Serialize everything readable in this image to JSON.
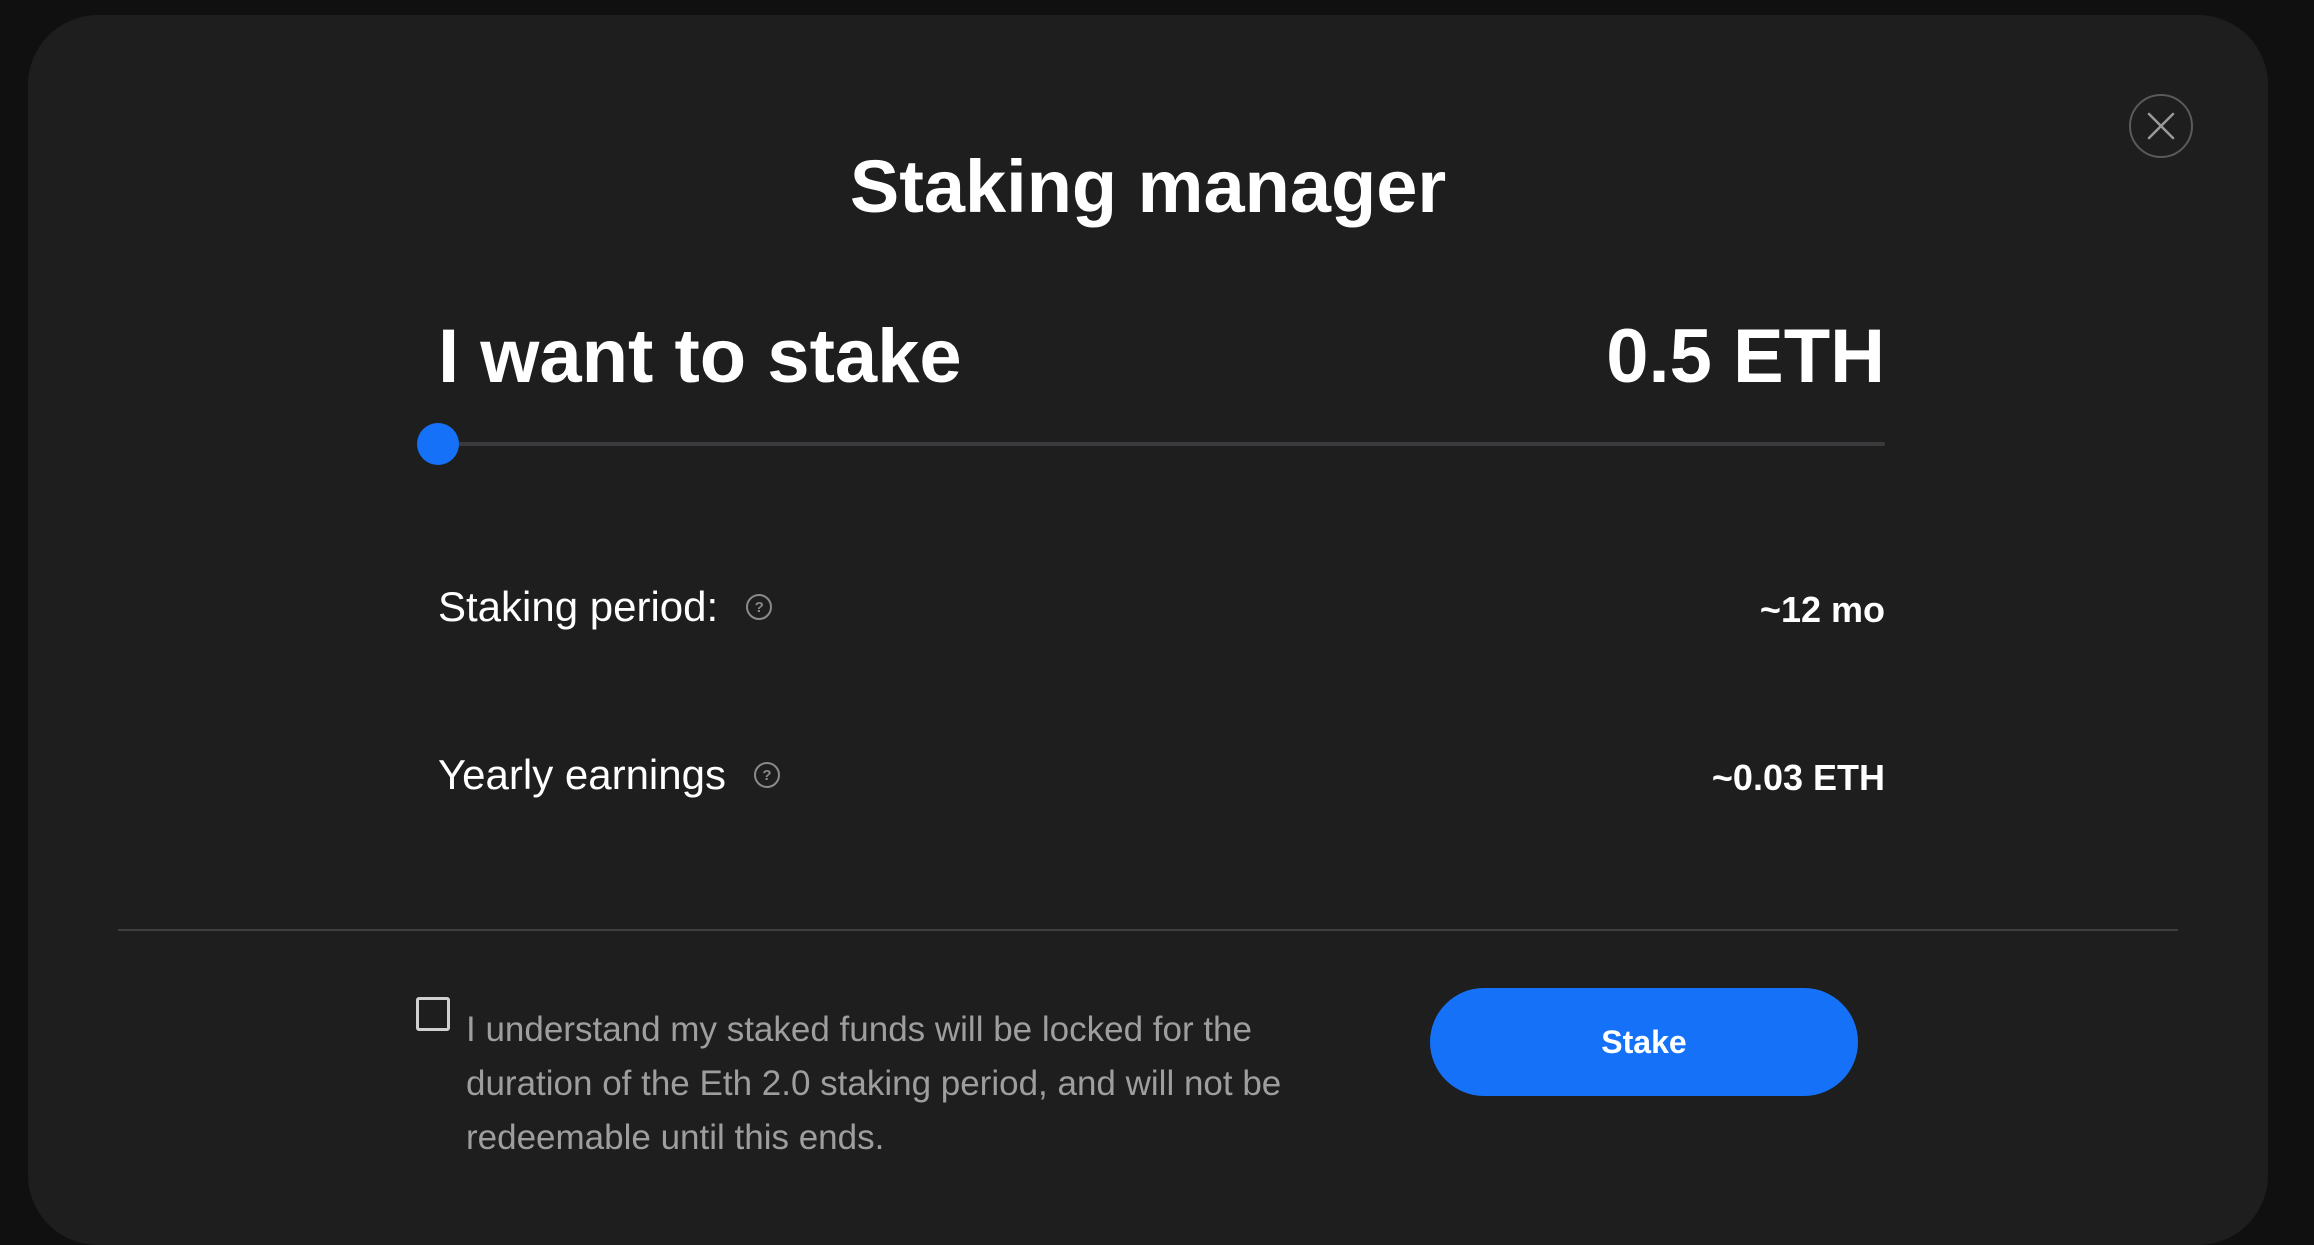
{
  "modal": {
    "title": "Staking manager",
    "close_icon": "close-icon"
  },
  "stake": {
    "label": "I want to stake",
    "amount": "0.5 ETH",
    "slider_fraction": 0,
    "accent_color": "#1572f8"
  },
  "details": {
    "period_label": "Staking period:",
    "period_value": "~12 mo",
    "earnings_label": "Yearly earnings",
    "earnings_value": "~0.03 ETH",
    "help_icon": "question-circle-icon",
    "help_glyph": "?"
  },
  "footer": {
    "checkbox_checked": false,
    "disclaimer": "I understand my staked funds will be locked for the duration of the Eth 2.0 staking period, and will not be redeemable until this ends.",
    "stake_button_label": "Stake"
  }
}
